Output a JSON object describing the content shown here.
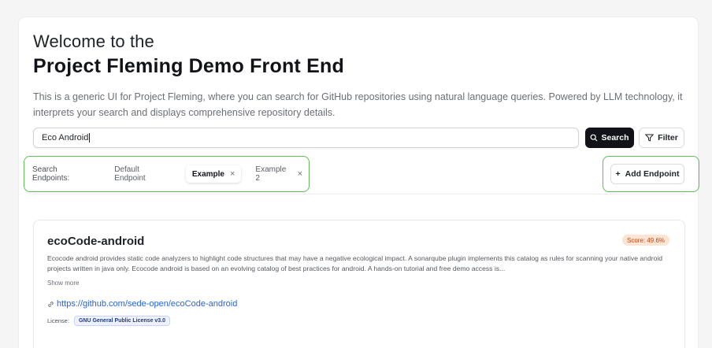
{
  "header": {
    "welcome": "Welcome to the",
    "title": "Project Fleming Demo Front End",
    "description": "This is a generic UI for Project Fleming, where you can search for GitHub repositories using natural language queries. Powered by LLM technology, it interprets your search and displays comprehensive repository details."
  },
  "search": {
    "value": "Eco Android",
    "search_label": "Search",
    "search_icon": "search-icon",
    "filter_label": "Filter",
    "filter_icon": "filter-icon"
  },
  "endpoints": {
    "label": "Search Endpoints:",
    "items": [
      {
        "label": "Default Endpoint",
        "active": false,
        "removable": false
      },
      {
        "label": "Example",
        "active": true,
        "removable": true
      },
      {
        "label": "Example 2",
        "active": false,
        "removable": true
      }
    ],
    "remove_glyph": "×",
    "add_label": "Add Endpoint",
    "add_glyph": "+"
  },
  "results": [
    {
      "name": "ecoCode-android",
      "score": "Score: 49.6%",
      "description": "Ecocode android provides static code analyzers to highlight code structures that may have a negative ecological impact. A sonarqube plugin implements this catalog as rules for scanning your native android projects written in java only. Ecocode android is based on an evolving catalog of best practices for android. A hands-on tutorial and free demo access is...",
      "show_more": "Show more",
      "url": "https://github.com/sede-open/ecoCode-android",
      "license_label": "License:",
      "license": "GNU General Public License v3.0"
    }
  ],
  "colors": {
    "highlight_outline": "#5fbf56",
    "primary_button": "#111318",
    "link": "#2563eb",
    "score_bg": "#fde5d4",
    "score_text": "#c2410c"
  }
}
